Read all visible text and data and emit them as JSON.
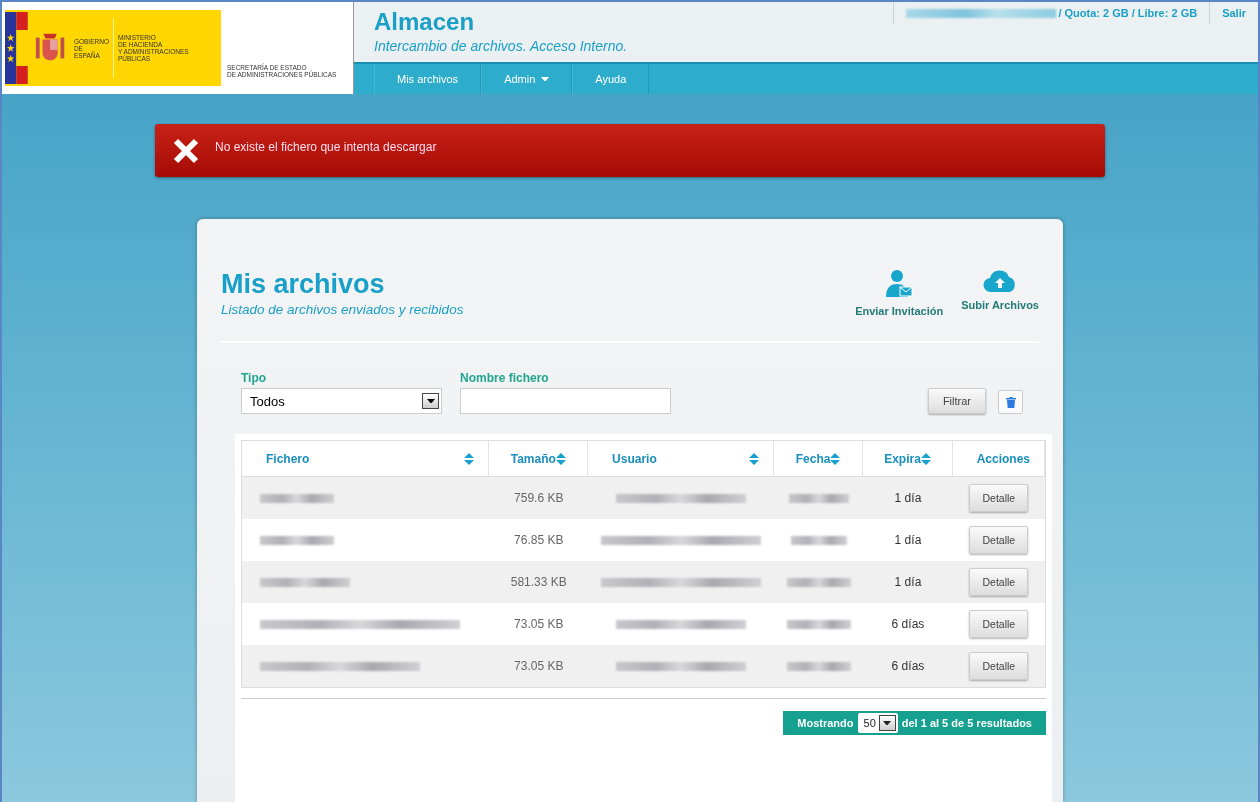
{
  "header": {
    "logo": {
      "gov_lines": [
        "GOBIERNO",
        "DE ESPAÑA"
      ],
      "ministry_lines": [
        "MINISTERIO",
        "DE HACIENDA",
        "Y ADMINISTRACIONES PÚBLICAS"
      ],
      "secretariat_lines": [
        "SECRETARÍA DE ESTADO",
        "DE ADMINISTRACIONES  PÚBLICAS"
      ]
    },
    "app_title": "Almacen",
    "app_subtitle": "Intercambio de archivos. Acceso Interno.",
    "quota": "/ Quota: 2 GB / Libre: 2 GB",
    "logout": "Salir",
    "nav": [
      {
        "label": "Mis archivos",
        "dropdown": false
      },
      {
        "label": "Admin",
        "dropdown": true
      },
      {
        "label": "Ayuda",
        "dropdown": false
      }
    ]
  },
  "alert": {
    "message": "No existe el fichero que intenta descargar"
  },
  "panel": {
    "title": "Mis archivos",
    "subtitle": "Listado de archivos enviados y recibidos",
    "actions": [
      {
        "kind": "invite",
        "label": "Enviar Invitación"
      },
      {
        "kind": "upload",
        "label": "Subir Archivos"
      }
    ],
    "filters": {
      "type_label": "Tipo",
      "type_value": "Todos",
      "name_label": "Nombre fichero",
      "filter_button": "Filtrar"
    },
    "table": {
      "columns": [
        {
          "label": "Fichero",
          "sortable": true
        },
        {
          "label": "Tamaño",
          "sortable": true
        },
        {
          "label": "Usuario",
          "sortable": true
        },
        {
          "label": "Fecha",
          "sortable": true
        },
        {
          "label": "Expira",
          "sortable": true
        },
        {
          "label": "Acciones",
          "sortable": false
        }
      ],
      "rows": [
        {
          "size": "759.6 KB",
          "expires": "1 día",
          "action": "Detalle"
        },
        {
          "size": "76.85 KB",
          "expires": "1 día",
          "action": "Detalle"
        },
        {
          "size": "581.33 KB",
          "expires": "1 día",
          "action": "Detalle"
        },
        {
          "size": "73.05 KB",
          "expires": "6 días",
          "action": "Detalle"
        },
        {
          "size": "73.05 KB",
          "expires": "6 días",
          "action": "Detalle"
        }
      ]
    },
    "pagination": {
      "prefix": "Mostrando",
      "page_size": "50",
      "suffix": "del 1 al 5 de 5 resultados"
    }
  }
}
